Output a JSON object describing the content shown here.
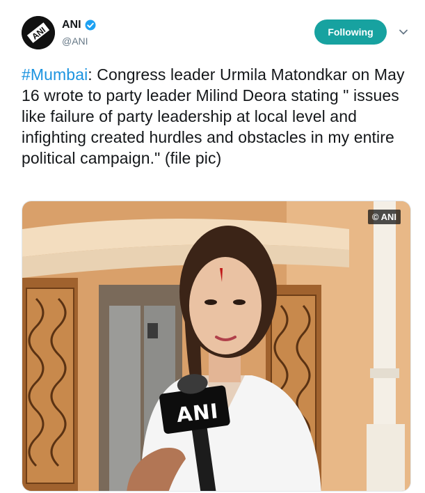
{
  "account": {
    "name": "ANI",
    "handle": "@ANI",
    "avatar_logo_text": "ANI",
    "verified_icon": "verified-badge-icon"
  },
  "follow_button": {
    "label": "Following",
    "color": "#17a2a0"
  },
  "menu": {
    "icon": "chevron-down-icon"
  },
  "tweet": {
    "hashtag": "#Mumbai",
    "text": ": Congress leader Urmila Matondkar on May 16 wrote to party leader Milind Deora stating \" issues like failure of party leadership at local level and infighting created hurdles and obstacles in my entire political campaign.\" (file pic)",
    "hashtag_color": "#1c94e0"
  },
  "media": {
    "watermark": "© ANI",
    "mic_logo": "ANI"
  }
}
